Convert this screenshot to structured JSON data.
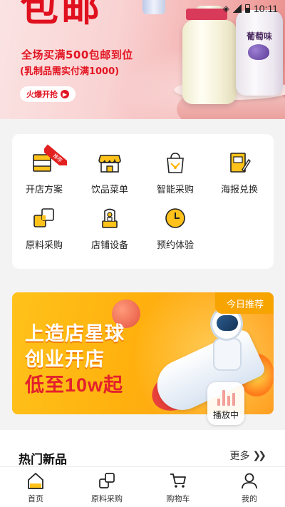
{
  "status_bar": {
    "time": "10:11"
  },
  "hero": {
    "big_title": "包邮",
    "promo_line": "全场买满500包邮到位",
    "promo_subline": "(乳制品需实付满1000)",
    "cta_label": "火爆开抢",
    "product_labels": {
      "grape": "葡萄味"
    }
  },
  "grid": {
    "items": [
      {
        "label": "开店方案",
        "icon": "shop-plan-icon",
        "badge": "推荐"
      },
      {
        "label": "饮品菜单",
        "icon": "drink-menu-icon"
      },
      {
        "label": "智能采购",
        "icon": "smart-purchase-icon"
      },
      {
        "label": "海报兑换",
        "icon": "poster-exchange-icon"
      },
      {
        "label": "原料采购",
        "icon": "ingredient-purchase-icon"
      },
      {
        "label": "店铺设备",
        "icon": "store-equipment-icon"
      },
      {
        "label": "预约体验",
        "icon": "appointment-icon"
      }
    ]
  },
  "promo": {
    "tag": "今日推荐",
    "line1": "上造店星球",
    "line2": "创业开店",
    "line3": "低至10w起"
  },
  "player": {
    "label": "播放中"
  },
  "hot_new": {
    "title": "热门新品",
    "more_label": "更多"
  },
  "tabbar": {
    "items": [
      {
        "label": "首页",
        "icon": "home-icon",
        "active": true
      },
      {
        "label": "原料采购",
        "icon": "ingredients-icon"
      },
      {
        "label": "购物车",
        "icon": "cart-icon"
      },
      {
        "label": "我的",
        "icon": "profile-icon"
      }
    ]
  },
  "colors": {
    "accent": "#f5a800",
    "brand_red": "#e0101e"
  }
}
